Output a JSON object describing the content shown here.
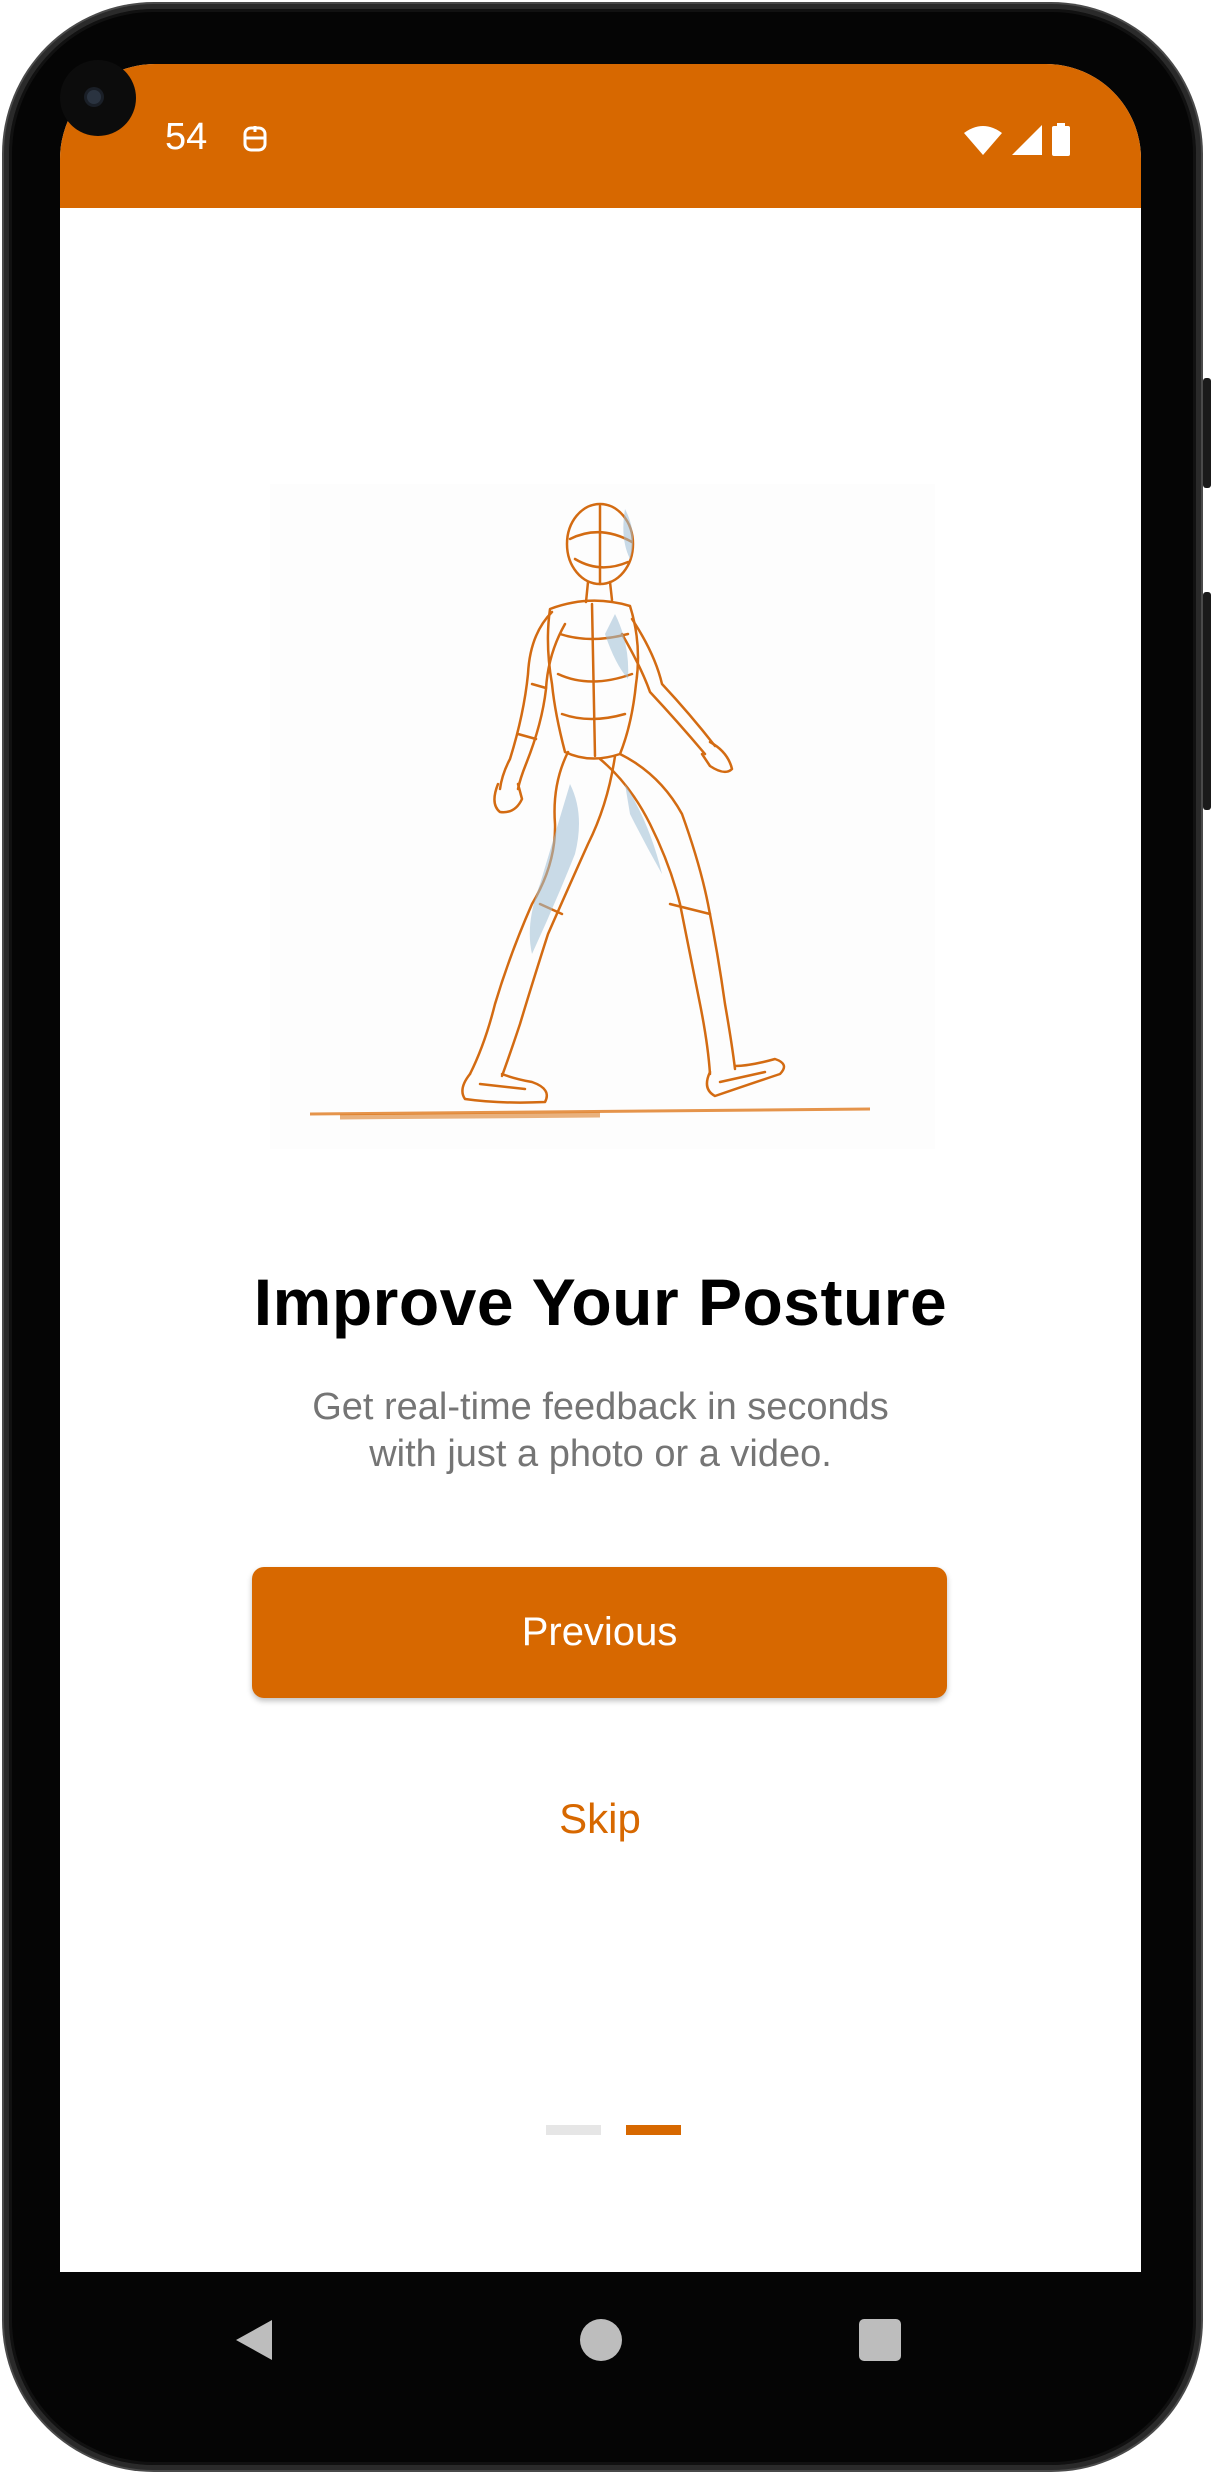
{
  "status_bar": {
    "time": "54",
    "background": "#d76800",
    "icons": [
      "notification-icon",
      "wifi-icon",
      "cellular-signal-icon",
      "battery-icon"
    ]
  },
  "onboarding": {
    "hero_image": "walking-human-wireframe",
    "title": "Improve Your Posture",
    "subtitle_line1": "Get real-time feedback in seconds",
    "subtitle_line2": "with just a photo or a video.",
    "primary_button_label": "Previous",
    "secondary_button_label": "Skip",
    "page_count": 2,
    "current_page": 2,
    "accent_color": "#d76800"
  },
  "nav_bar": {
    "buttons": [
      "back-icon",
      "home-icon",
      "recents-icon"
    ]
  }
}
